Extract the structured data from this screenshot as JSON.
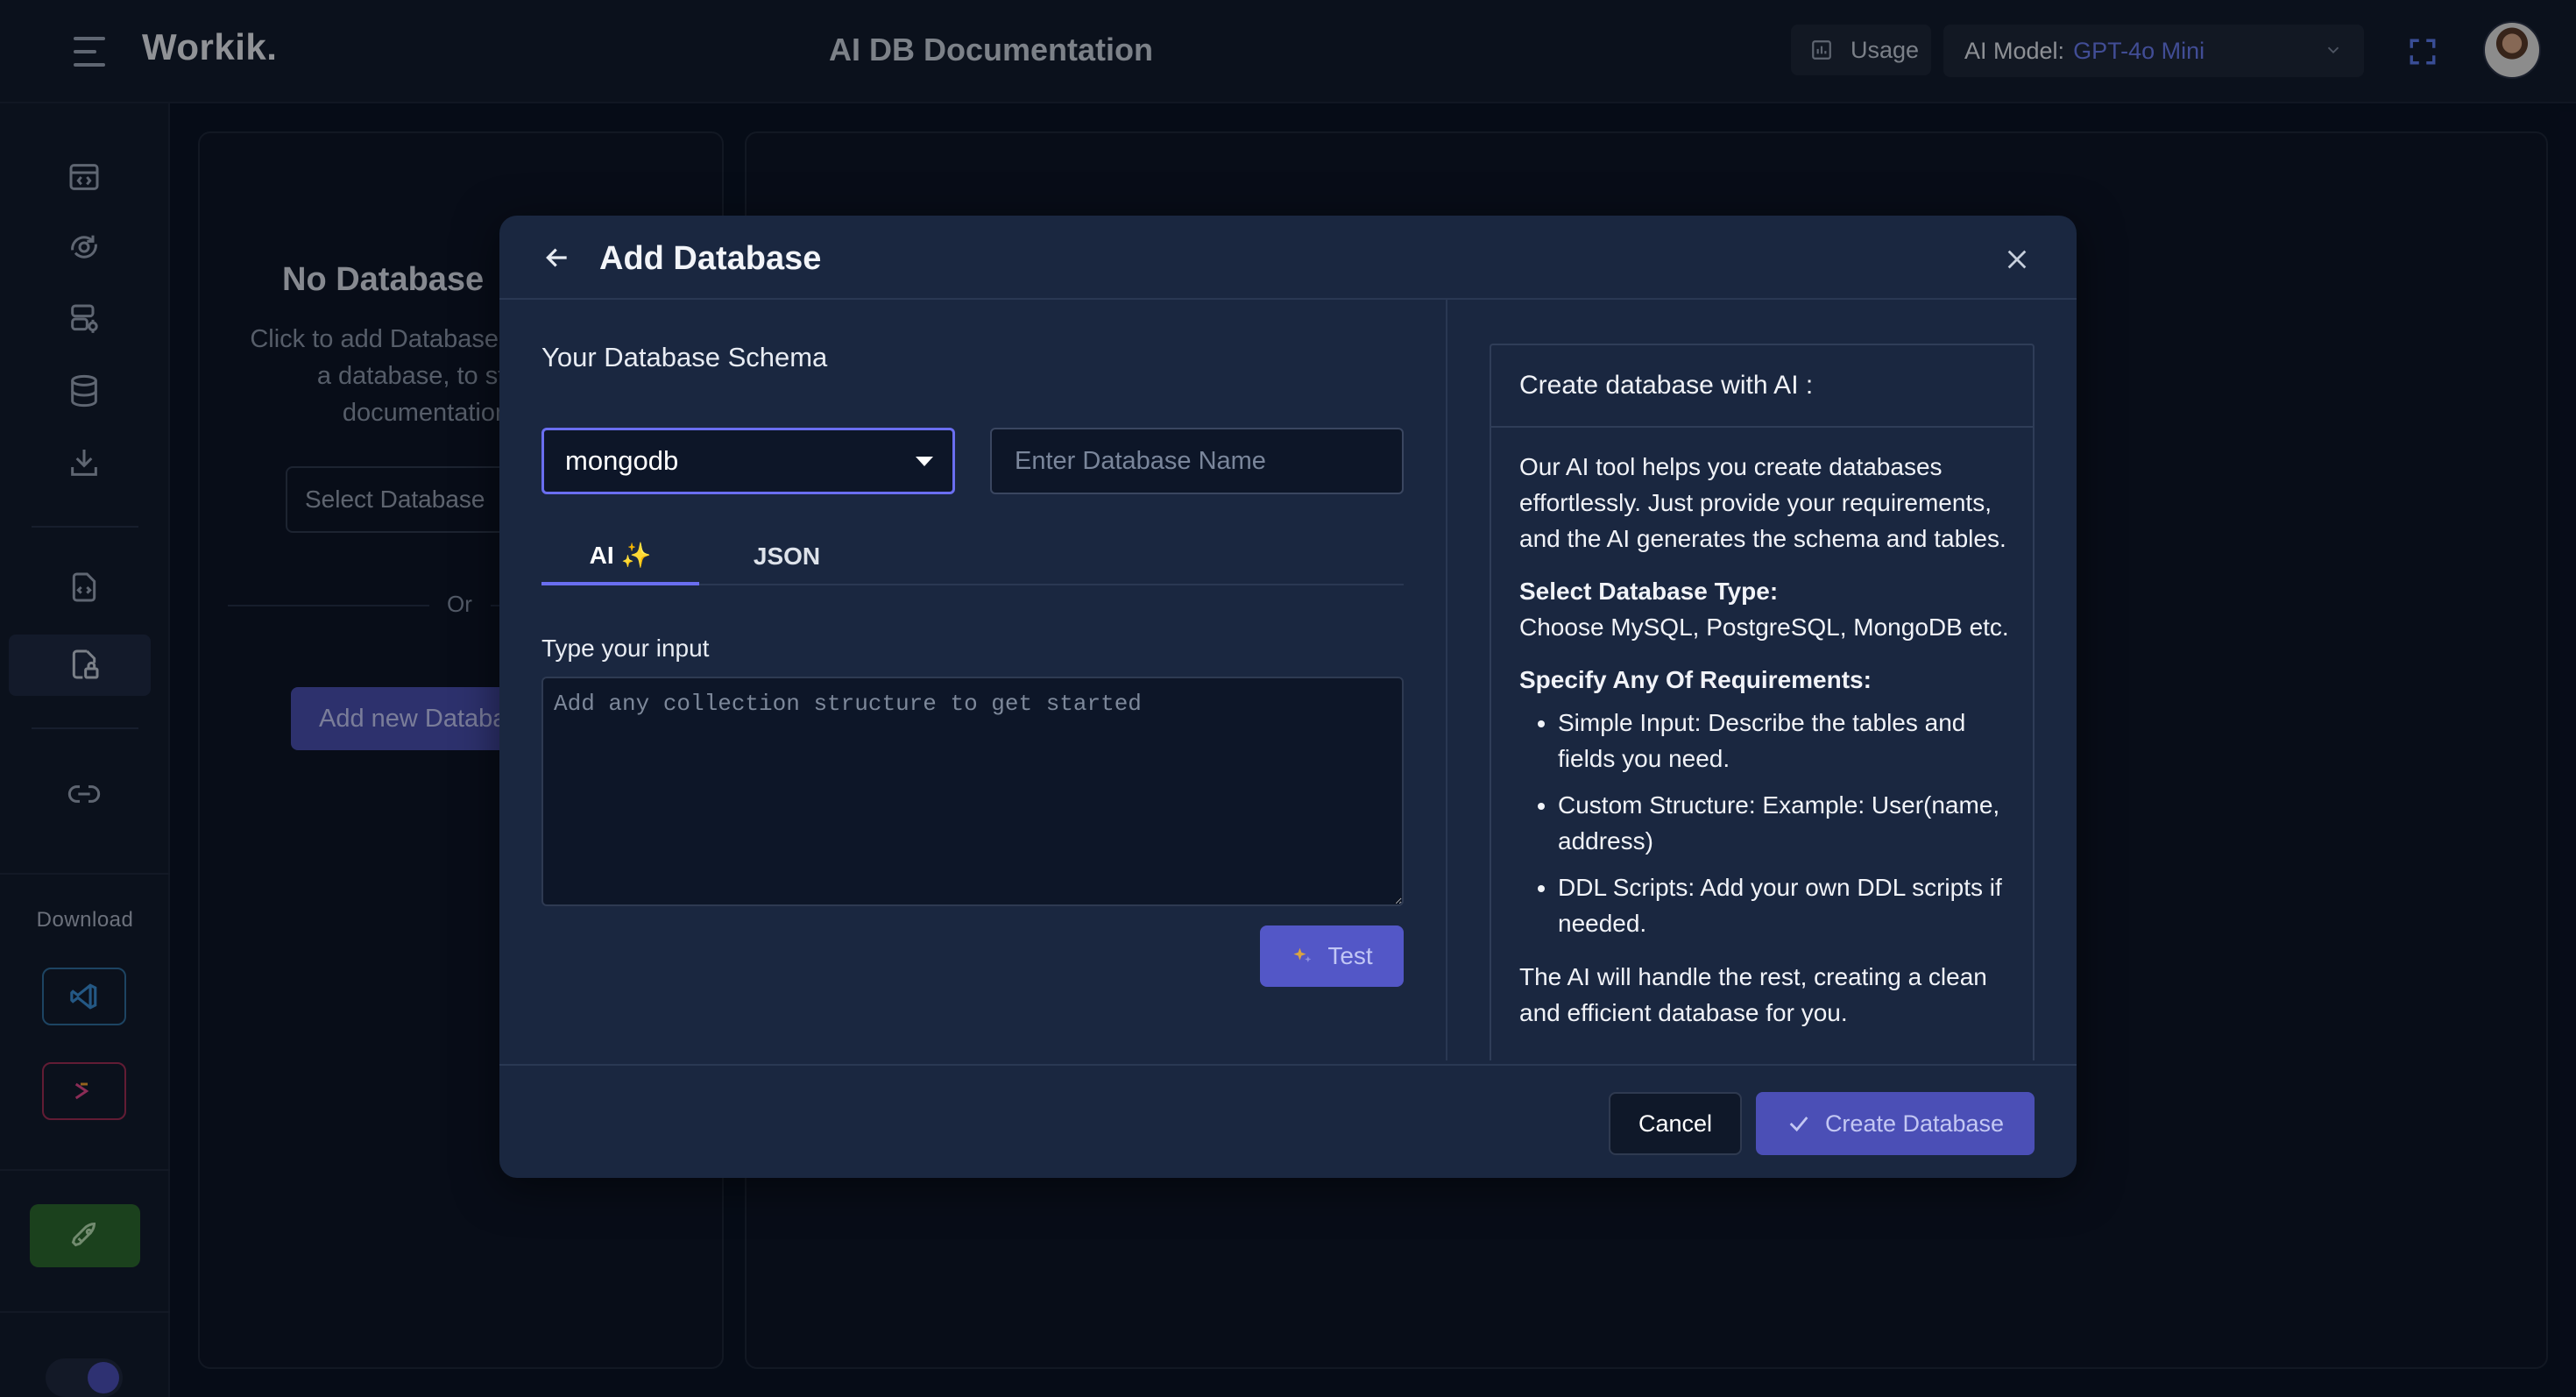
{
  "header": {
    "logo": "Workik.",
    "title": "AI DB Documentation",
    "usage_label": "Usage",
    "model_label": "AI Model:",
    "model_value": "GPT-4o Mini"
  },
  "sidebar": {
    "download_label": "Download",
    "icons": [
      "layout-code-icon",
      "ai-cog-icon",
      "database-cog-icon",
      "database-icon",
      "download-icon",
      "file-code-icon",
      "file-lock-icon",
      "link-icon"
    ],
    "active_index": 6
  },
  "background_panel": {
    "title": "No Database",
    "description": "Click to add Database or select a database, to start documentation",
    "select_placeholder": "Select Database",
    "or_label": "Or",
    "add_new_label": "Add new Database"
  },
  "modal": {
    "title": "Add Database",
    "schema_label": "Your Database Schema",
    "db_type": "mongodb",
    "db_name_placeholder": "Enter Database Name",
    "tabs": [
      {
        "label": "AI ✨",
        "active": true
      },
      {
        "label": "JSON",
        "active": false
      }
    ],
    "input_label": "Type your input",
    "input_placeholder": "Add any collection structure to get started",
    "test_label": "Test",
    "info": {
      "title": "Create database with AI :",
      "intro": "Our AI tool helps you create databases effortlessly. Just provide your requirements, and the AI generates the schema and tables.",
      "type_heading": "Select Database Type:",
      "type_text": "Choose MySQL, PostgreSQL, MongoDB etc.",
      "req_heading": "Specify Any Of Requirements:",
      "bullets": [
        "Simple Input: Describe the tables and fields you need.",
        "Custom Structure: Example: User(name, address)",
        "DDL Scripts: Add your own DDL scripts if needed."
      ],
      "outro": "The AI will handle the rest, creating a clean and efficient database for you."
    },
    "cancel_label": "Cancel",
    "create_label": "Create Database"
  },
  "colors": {
    "accent": "#6a6ef0",
    "modal_bg": "#1a2740",
    "page_bg": "#0b1426"
  }
}
